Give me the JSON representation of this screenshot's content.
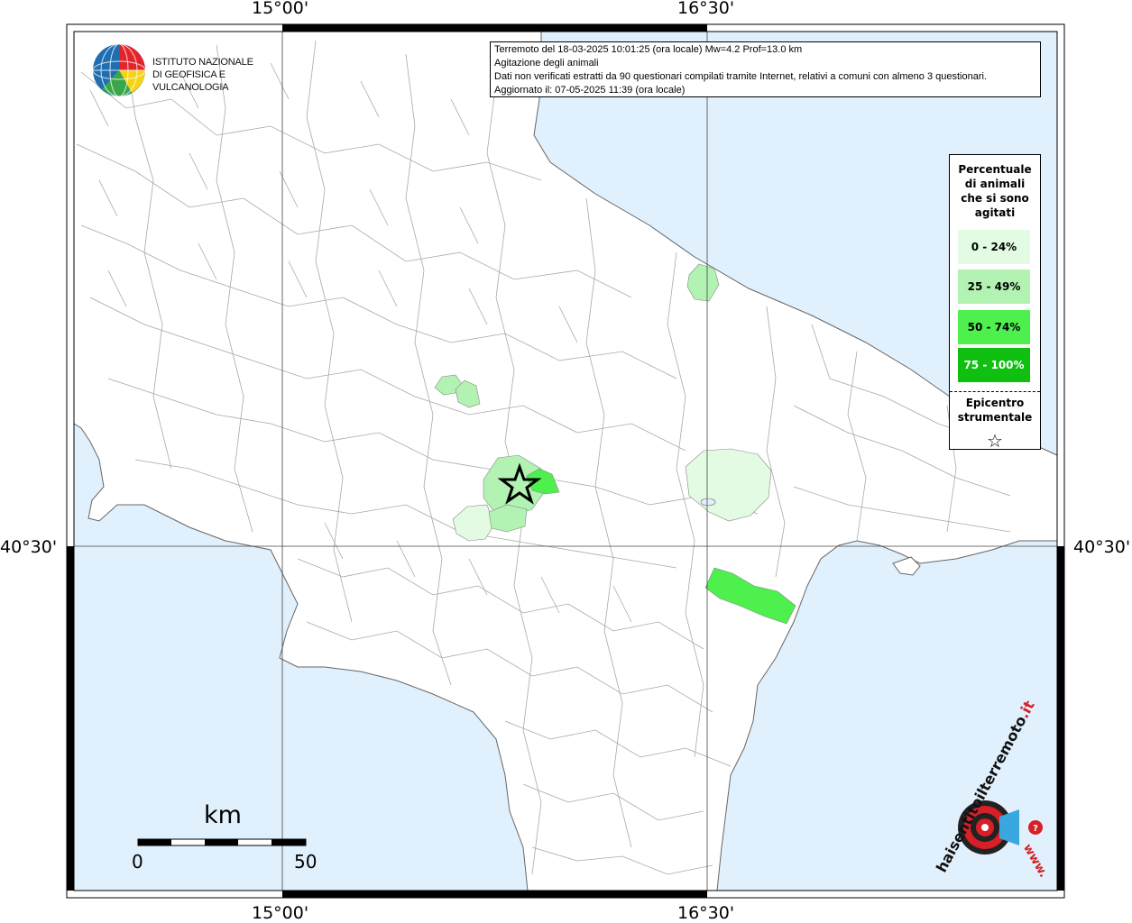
{
  "map": {
    "grid_labels": {
      "lon_west": "15°00'",
      "lon_east": "16°30'",
      "lat": "40°30'"
    },
    "colors": {
      "sea": "#e0f0fc",
      "land": "#ffffff",
      "border": "#9a9a9a",
      "class_0_24": "#e2fbe2",
      "class_25_49": "#b2f2b2",
      "class_50_74": "#4ef04e",
      "class_75_100": "#10c010"
    }
  },
  "info": {
    "line1": "Terremoto del 18-03-2025 10:01:25 (ora locale) Mw=4.2 Prof=13.0 km",
    "line2": "Agitazione degli animali",
    "line3": "Dati non verificati estratti da 90 questionari compilati tramite Internet, relativi a comuni con almeno 3 questionari.",
    "line4": "Aggiornato il: 07-05-2025 11:39 (ora locale)"
  },
  "legend": {
    "title_lines": [
      "Percentuale",
      "di animali",
      "che si sono",
      "agitati"
    ],
    "items": [
      {
        "label": "0 - 24%",
        "color": "#e2fbe2",
        "text_color": "#000000"
      },
      {
        "label": "25 - 49%",
        "color": "#b2f2b2",
        "text_color": "#000000"
      },
      {
        "label": "50 - 74%",
        "color": "#4ef04e",
        "text_color": "#000000"
      },
      {
        "label": "75 - 100%",
        "color": "#10c010",
        "text_color": "#ffffff"
      }
    ],
    "epicenter_lines": [
      "Epicentro",
      "strumentale"
    ],
    "star_glyph": "☆"
  },
  "ingv": {
    "line1": "ISTITUTO NAZIONALE",
    "line2": "DI GEOFISICA E VULCANOLOGIA",
    "icon": "ingv-globe-icon"
  },
  "scalebar": {
    "unit": "km",
    "min_label": "0",
    "max_label": "50"
  },
  "hsit": {
    "text_main": "haisentitoilterremoto",
    "text_tld": ".it",
    "text_www": "www.",
    "icon": "hsit-target-icon"
  }
}
